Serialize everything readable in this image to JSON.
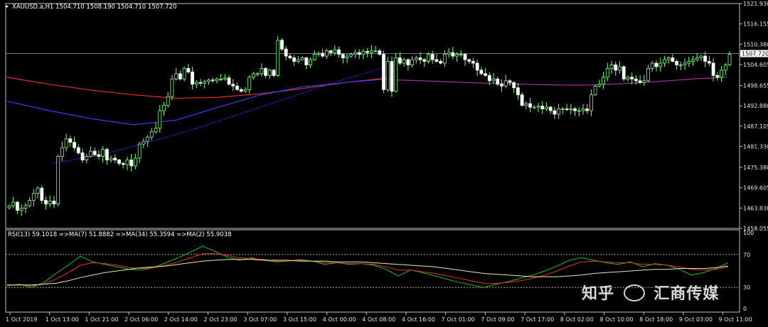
{
  "chart_data": [
    {
      "type": "candlestick",
      "symbol_header": "XAUUSD.a",
      "timeframe": "H1",
      "ohlc_header": [
        "1504.710",
        "1508.190",
        "1504.710",
        "1507.720"
      ],
      "current_price": 1507.72,
      "current_price_label": "1507.720",
      "ylim": [
        1458.05,
        1521.93
      ],
      "y_ticks": [
        "1521.930",
        "1516.155",
        "1510.380",
        "1504.605",
        "1498.655",
        "1492.880",
        "1487.105",
        "1481.330",
        "1475.380",
        "1469.605",
        "1463.830",
        "1458.055"
      ],
      "x_ticks": [
        "1 Oct 2019",
        "1 Oct 13:00",
        "1 Oct 21:00",
        "2 Oct 06:00",
        "2 Oct 14:00",
        "2 Oct 23:00",
        "3 Oct 07:00",
        "3 Oct 15:00",
        "4 Oct 00:00",
        "4 Oct 08:00",
        "4 Oct 16:00",
        "7 Oct 01:00",
        "7 Oct 09:00",
        "7 Oct 17:00",
        "8 Oct 02:00",
        "8 Oct 10:00",
        "8 Oct 18:00",
        "9 Oct 03:00",
        "9 Oct 11:00"
      ],
      "series": [
        {
          "kind": "candles",
          "closes": [
            1464.5,
            1465.5,
            1463.2,
            1463.8,
            1464.5,
            1466.0,
            1468.0,
            1469.5,
            1466.0,
            1465.0,
            1465.8,
            1465.0,
            1478.5,
            1481.0,
            1483.5,
            1482.5,
            1481.0,
            1479.5,
            1477.5,
            1478.5,
            1480.0,
            1479.0,
            1478.5,
            1480.5,
            1477.5,
            1478.0,
            1477.5,
            1476.5,
            1476.2,
            1477.5,
            1475.8,
            1478.0,
            1482.0,
            1482.8,
            1484.0,
            1485.5,
            1486.5,
            1491.5,
            1493.0,
            1495.5,
            1500.5,
            1502.0,
            1500.5,
            1503.5,
            1502.5,
            1499.0,
            1499.5,
            1499.3,
            1499.8,
            1500.2,
            1500.0,
            1500.5,
            1500.5,
            1500.8,
            1499.0,
            1498.5,
            1497.5,
            1497.0,
            1497.5,
            1501.0,
            1502.0,
            1502.0,
            1503.5,
            1501.5,
            1503.0,
            1501.5,
            1511.5,
            1509.0,
            1507.0,
            1506.5,
            1505.5,
            1506.0,
            1506.5,
            1504.5,
            1506.0,
            1507.5,
            1507.8,
            1507.0,
            1508.5,
            1508.0,
            1508.8,
            1507.5,
            1506.5,
            1507.0,
            1507.5,
            1508.0,
            1507.5,
            1508.3,
            1508.0,
            1508.5,
            1508.5,
            1507.5,
            1497.5,
            1505.5,
            1497.0,
            1506.5,
            1505.0,
            1506.0,
            1504.5,
            1506.0,
            1506.5,
            1506.0,
            1505.5,
            1507.5,
            1506.0,
            1505.5,
            1505.0,
            1507.5,
            1508.0,
            1507.0,
            1507.5,
            1507.5,
            1506.0,
            1505.5,
            1505.0,
            1503.0,
            1502.0,
            1501.5,
            1500.0,
            1500.5,
            1499.0,
            1498.5,
            1500.0,
            1499.5,
            1498.0,
            1496.0,
            1493.0,
            1493.5,
            1492.5,
            1492.5,
            1492.8,
            1492.0,
            1492.5,
            1491.5,
            1490.5,
            1492.0,
            1492.0,
            1491.8,
            1492.0,
            1491.5,
            1491.5,
            1492.0,
            1491.5,
            1496.0,
            1498.5,
            1499.0,
            1501.0,
            1503.5,
            1504.5,
            1503.0,
            1504.0,
            1500.5,
            1501.0,
            1500.5,
            1500.0,
            1499.5,
            1500.0,
            1503.5,
            1505.0,
            1504.0,
            1505.0,
            1506.0,
            1506.5,
            1505.5,
            1504.5,
            1504.5,
            1505.0,
            1505.5,
            1506.0,
            1506.5,
            1507.0,
            1505.5,
            1505.0,
            1501.5,
            1501.0,
            1503.0,
            1504.5,
            1507.5
          ]
        },
        {
          "kind": "ma",
          "color": "#e8302a",
          "values": [
            1501.0,
            1499.0,
            1497.3,
            1496.0,
            1495.0,
            1495.3,
            1496.3,
            1497.8,
            1499.5,
            1500.8
          ]
        },
        {
          "kind": "ma",
          "color": "#3a3aff",
          "values": [
            1494.2,
            1491.5,
            1489.2,
            1487.5,
            1488.8,
            1492.5,
            1496.0,
            1498.3,
            1499.5,
            1500.5
          ]
        },
        {
          "kind": "ma",
          "color": "#a638a6",
          "values": [
            1500.3,
            1500.0,
            1499.6,
            1499.3,
            1499.0,
            1498.8,
            1498.8,
            1499.2,
            1499.8,
            1500.5,
            1501.0
          ]
        },
        {
          "kind": "ma",
          "color": "#2a2aff",
          "style": "dashed",
          "values": [
            1476.5,
            1479.0,
            1482.5,
            1486.5,
            1491.0,
            1495.5,
            1500.0,
            1504.0
          ]
        }
      ]
    },
    {
      "type": "line",
      "panel": "indicator",
      "header": "RSI(13) 59.1018  =>MA(7) 51.8882  =>MA(34) 55.3594  =>MA(2) 55.9038",
      "ylim": [
        0,
        100
      ],
      "y_ticks": [
        "100",
        "70",
        "30",
        "0"
      ],
      "levels": [
        70,
        30
      ],
      "series": [
        {
          "color": "#18c018",
          "values": [
            32,
            34,
            30,
            36,
            47,
            57,
            68,
            61,
            58,
            55,
            52,
            51,
            54,
            60,
            66,
            73,
            80,
            74,
            67,
            63,
            66,
            63,
            61,
            62,
            64,
            62,
            58,
            60,
            58,
            59,
            57,
            52,
            44,
            51,
            48,
            44,
            40,
            36,
            33,
            30,
            34,
            37,
            41,
            45,
            50,
            56,
            63,
            66,
            63,
            60,
            58,
            61,
            55,
            59,
            57,
            52,
            45,
            48,
            53,
            60
          ]
        },
        {
          "color": "#e8302a",
          "values": [
            33,
            33,
            32,
            34,
            40,
            48,
            57,
            60,
            59,
            57,
            54,
            53,
            54,
            57,
            61,
            66,
            71,
            71,
            69,
            66,
            65,
            64,
            62,
            62,
            63,
            62,
            60,
            60,
            59,
            59,
            58,
            55,
            51,
            51,
            49,
            47,
            44,
            41,
            38,
            35,
            35,
            36,
            38,
            41,
            45,
            50,
            56,
            61,
            62,
            61,
            60,
            60,
            58,
            58,
            57,
            55,
            52,
            51,
            52,
            55
          ]
        },
        {
          "color": "#e8e8b0",
          "values": [
            33,
            33,
            33,
            34,
            35,
            38,
            42,
            45,
            48,
            50,
            52,
            54,
            55,
            56,
            58,
            60,
            62,
            63,
            64,
            64,
            64,
            63,
            63,
            63,
            62,
            62,
            62,
            61,
            61,
            61,
            60,
            59,
            58,
            57,
            56,
            55,
            53,
            51,
            49,
            47,
            46,
            45,
            44,
            43,
            43,
            43,
            44,
            45,
            47,
            48,
            49,
            50,
            51,
            52,
            52,
            53,
            53,
            53,
            54,
            56
          ]
        }
      ]
    }
  ],
  "watermark": {
    "left": "知乎",
    "right": "汇商传媒"
  }
}
